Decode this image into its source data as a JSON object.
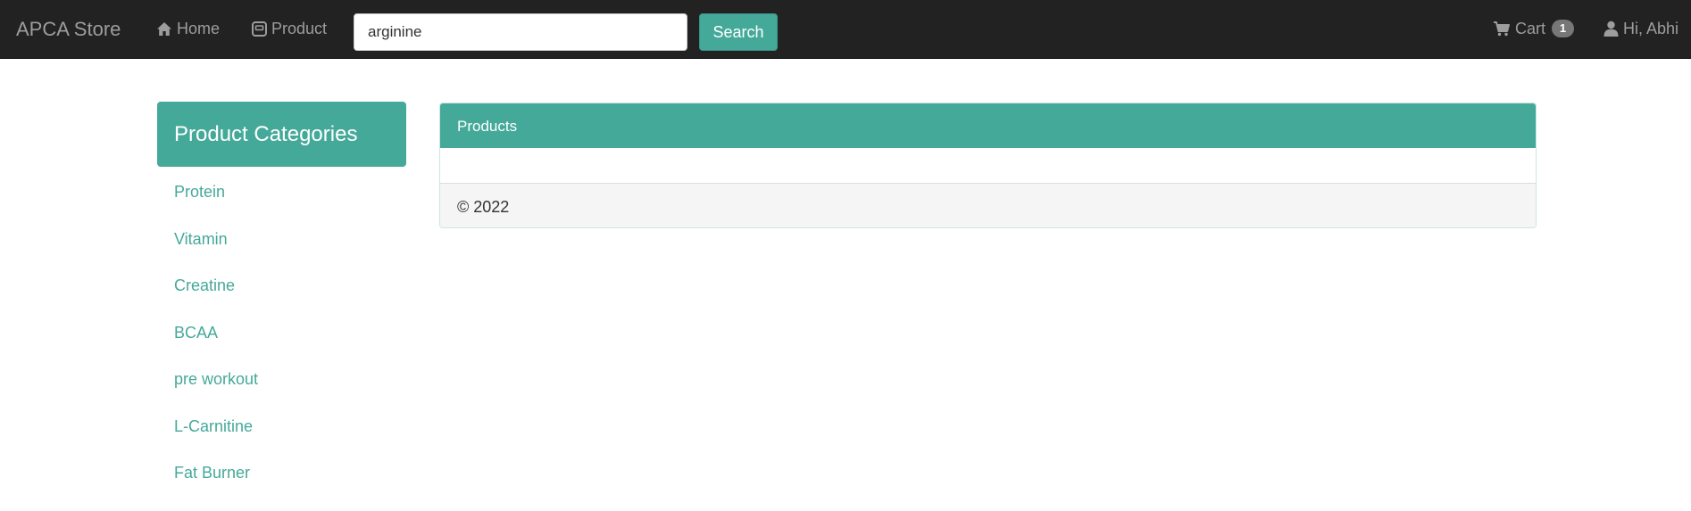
{
  "navbar": {
    "brand": "APCA Store",
    "home_label": "Home",
    "home_icon": "home-icon",
    "product_label": "Product",
    "product_icon": "product-icon",
    "search": {
      "value": "arginine",
      "button_label": "Search"
    },
    "cart_label": "Cart",
    "cart_icon": "cart-icon",
    "cart_count": "1",
    "user_label": "Hi, Abhi",
    "user_icon": "user-icon"
  },
  "sidebar": {
    "title": "Product Categories",
    "items": [
      {
        "label": "Protein"
      },
      {
        "label": "Vitamin"
      },
      {
        "label": "Creatine"
      },
      {
        "label": "BCAA"
      },
      {
        "label": "pre workout"
      },
      {
        "label": "L-Carnitine"
      },
      {
        "label": "Fat Burner"
      }
    ]
  },
  "products_panel": {
    "title": "Products",
    "footer": "© 2022"
  },
  "colors": {
    "navbar_bg": "#222222",
    "navbar_text": "#9d9d9d",
    "accent": "#45a99a",
    "badge_bg": "#777777",
    "footer_bg": "#f5f5f5"
  }
}
